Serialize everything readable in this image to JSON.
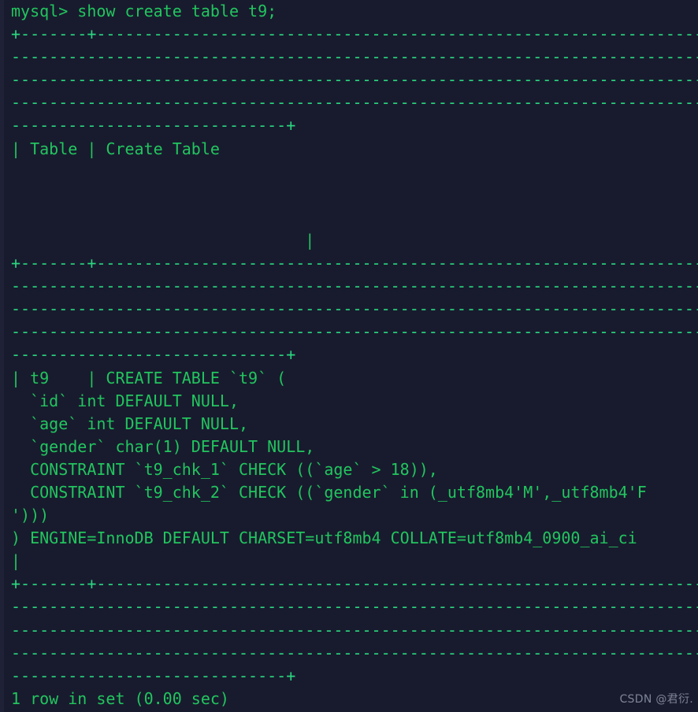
{
  "terminal": {
    "background_color": "#181b2e",
    "text_color": "#22c55e",
    "separator_color": "#2ad67f",
    "prompt": "mysql> ",
    "command": "show create table t9;",
    "lines": [
      {
        "name": "command-line",
        "kind": "command",
        "text": "mysql> show create table t9;"
      },
      {
        "name": "separator-top",
        "kind": "sep",
        "text": "+-------+--------------------------------------------------------------------"
      },
      {
        "name": "separator-top-2",
        "kind": "sep",
        "text": "--------------------------------------------------------------------------"
      },
      {
        "name": "separator-top-3",
        "kind": "sep",
        "text": "--------------------------------------------------------------------------"
      },
      {
        "name": "separator-top-4",
        "kind": "sep",
        "text": "--------------------------------------------------------------------------"
      },
      {
        "name": "separator-top-5",
        "kind": "sep",
        "text": "-----------------------------+"
      },
      {
        "name": "header-row",
        "kind": "text",
        "text": "| Table | Create Table"
      },
      {
        "name": "header-row-pad-1",
        "kind": "blank",
        "text": " "
      },
      {
        "name": "header-row-pad-2",
        "kind": "blank",
        "text": " "
      },
      {
        "name": "header-row-pad-3",
        "kind": "blank",
        "text": " "
      },
      {
        "name": "header-row-end",
        "kind": "text",
        "text": "                               |"
      },
      {
        "name": "separator-mid",
        "kind": "sep",
        "text": "+-------+--------------------------------------------------------------------"
      },
      {
        "name": "separator-mid-2",
        "kind": "sep",
        "text": "--------------------------------------------------------------------------"
      },
      {
        "name": "separator-mid-3",
        "kind": "sep",
        "text": "--------------------------------------------------------------------------"
      },
      {
        "name": "separator-mid-4",
        "kind": "sep",
        "text": "--------------------------------------------------------------------------"
      },
      {
        "name": "separator-mid-5",
        "kind": "sep",
        "text": "-----------------------------+"
      },
      {
        "name": "data-row-create",
        "kind": "text",
        "text": "| t9    | CREATE TABLE `t9` ("
      },
      {
        "name": "ddl-column-id",
        "kind": "text",
        "text": "  `id` int DEFAULT NULL,"
      },
      {
        "name": "ddl-column-age",
        "kind": "text",
        "text": "  `age` int DEFAULT NULL,"
      },
      {
        "name": "ddl-column-gender",
        "kind": "text",
        "text": "  `gender` char(1) DEFAULT NULL,"
      },
      {
        "name": "ddl-constraint-1",
        "kind": "text",
        "text": "  CONSTRAINT `t9_chk_1` CHECK ((`age` > 18)),"
      },
      {
        "name": "ddl-constraint-2",
        "kind": "text",
        "text": "  CONSTRAINT `t9_chk_2` CHECK ((`gender` in (_utf8mb4'M',_utf8mb4'F"
      },
      {
        "name": "ddl-constraint-2-wrap",
        "kind": "text",
        "text": "')))"
      },
      {
        "name": "ddl-table-options",
        "kind": "text",
        "text": ") ENGINE=InnoDB DEFAULT CHARSET=utf8mb4 COLLATE=utf8mb4_0900_ai_ci"
      },
      {
        "name": "data-row-end",
        "kind": "text",
        "text": "|"
      },
      {
        "name": "separator-bot",
        "kind": "sep",
        "text": "+-------+--------------------------------------------------------------------"
      },
      {
        "name": "separator-bot-2",
        "kind": "sep",
        "text": "--------------------------------------------------------------------------"
      },
      {
        "name": "separator-bot-3",
        "kind": "sep",
        "text": "--------------------------------------------------------------------------"
      },
      {
        "name": "separator-bot-4",
        "kind": "sep",
        "text": "--------------------------------------------------------------------------"
      },
      {
        "name": "separator-bot-5",
        "kind": "sep",
        "text": "-----------------------------+"
      },
      {
        "name": "result-status",
        "kind": "text",
        "text": "1 row in set (0.00 sec)"
      }
    ],
    "result_status": "1 row in set (0.00 sec)",
    "table": {
      "columns": [
        "Table",
        "Create Table"
      ],
      "rows": [
        {
          "Table": "t9",
          "Create Table": "CREATE TABLE `t9` (\n  `id` int DEFAULT NULL,\n  `age` int DEFAULT NULL,\n  `gender` char(1) DEFAULT NULL,\n  CONSTRAINT `t9_chk_1` CHECK ((`age` > 18)),\n  CONSTRAINT `t9_chk_2` CHECK ((`gender` in (_utf8mb4'M',_utf8mb4'F')))\n) ENGINE=InnoDB DEFAULT CHARSET=utf8mb4 COLLATE=utf8mb4_0900_ai_ci"
        }
      ]
    }
  },
  "watermark": {
    "text": "CSDN @君衍.",
    "color": "#7f8496"
  }
}
